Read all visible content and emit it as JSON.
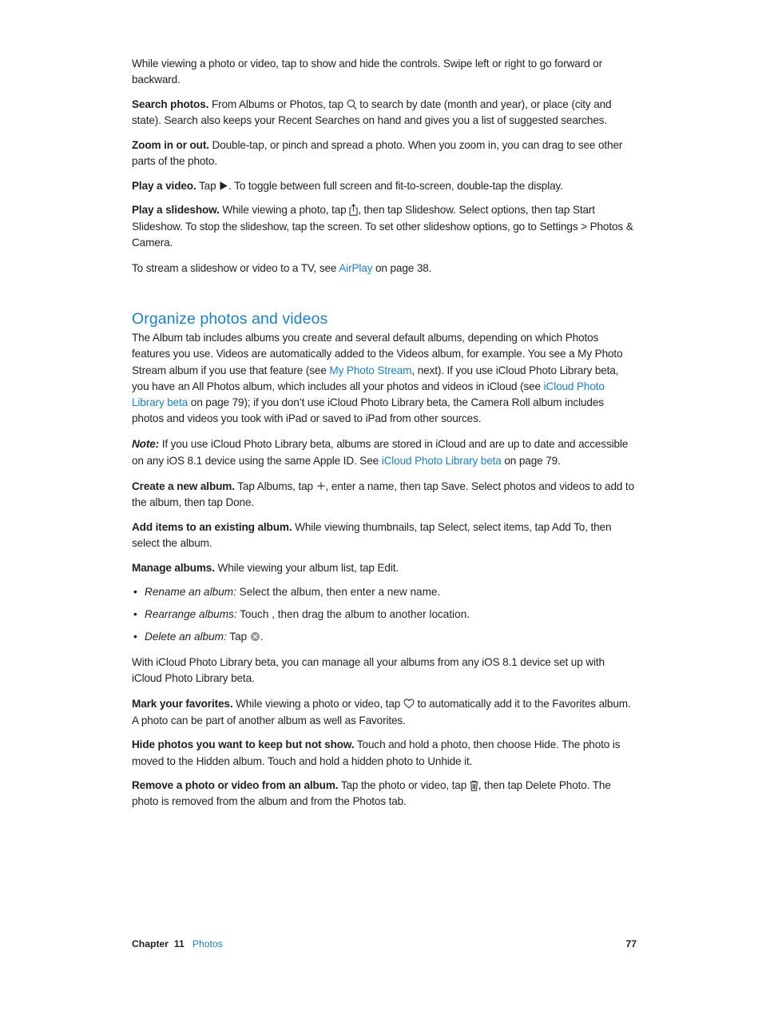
{
  "document": {
    "page_number": "77",
    "footer": {
      "chapter_word": "Chapter",
      "chapter_number": "11",
      "chapter_link": "Photos"
    }
  },
  "body": {
    "intro_paragraph": "While viewing a photo or video, tap to show and hide the controls. Swipe left or right to go forward or backward.",
    "search_photos": {
      "lead": "Search photos.",
      "text_before_icon": " From Albums or Photos, tap ",
      "icon": "search-icon",
      "text_after_icon": " to search by date (month and year), or place (city and state). Search also keeps your Recent Searches on hand and gives you a list of suggested searches."
    },
    "zoom_in_or_out": {
      "lead": "Zoom in or out.",
      "text": " Double-tap, or pinch and spread a photo. When you zoom in, you can drag to see other parts of the photo."
    },
    "play_a_video": {
      "lead": "Play a video.",
      "text_before_icon": " Tap ",
      "icon": "play-icon",
      "text_after_icon": ". To toggle between full screen and fit-to-screen, double-tap the display."
    },
    "play_a_slideshow": {
      "lead": "Play a slideshow.",
      "text_before_icon": " While viewing a photo, tap ",
      "icon": "share-icon",
      "text_after_icon": ", then tap Slideshow. Select options, then tap Start Slideshow. To stop the slideshow, tap the screen. To set other slideshow options, go to Settings > Photos & Camera."
    },
    "airplay_note": {
      "text_before_link": "To stream a slideshow or video to a TV, see ",
      "link": "AirPlay",
      "text_after_link": " on page 38."
    },
    "section_heading": "Organize photos and videos",
    "album_tab_paragraph": {
      "part1": "The Album tab includes albums you create and several default albums, depending on which Photos features you use. Videos are automatically added to the Videos album, for example. You see a My Photo Stream album if you use that feature (see ",
      "link1": "My Photo Stream",
      "part2": ", next). If you use iCloud Photo Library beta, you have an All Photos album, which includes all your photos and videos in iCloud (see ",
      "link2": "iCloud Photo Library beta",
      "part3": " on page 79); if you don’t use iCloud Photo Library beta, the Camera Roll album includes photos and videos you took with iPad or saved to iPad from other sources."
    },
    "note_paragraph": {
      "lead": "Note:",
      "part1": "  If you use iCloud Photo Library beta, albums are stored in iCloud and are up to date and accessible on any iOS 8.1 device using the same Apple ID. See ",
      "link": "iCloud Photo Library beta",
      "part2": " on page 79."
    },
    "create_new_album": {
      "lead": "Create a new album.",
      "text_before_icon": " Tap Albums, tap ",
      "icon": "plus-icon",
      "text_after_icon": ", enter a name, then tap Save. Select photos and videos to add to the album, then tap Done."
    },
    "add_items": {
      "lead": "Add items to an existing album.",
      "text": " While viewing thumbnails, tap Select, select items, tap Add To, then select the album."
    },
    "manage_albums": {
      "lead": "Manage albums.",
      "text": " While viewing your album list, tap Edit.",
      "bullets": [
        {
          "term": "Rename an album:",
          "text_before_icon": "  Select the album, then enter a new name.",
          "icon": null,
          "text_after_icon": ""
        },
        {
          "term": "Rearrange albums:",
          "text_before_icon": "  Touch , then drag the album to another location.",
          "icon": null,
          "text_after_icon": ""
        },
        {
          "term": "Delete an album:",
          "text_before_icon": "  Tap ",
          "icon": "delete-circle-icon",
          "text_after_icon": "."
        }
      ]
    },
    "icloud_manage_paragraph": "With iCloud Photo Library beta, you can manage all your albums from any iOS 8.1 device set up with iCloud Photo Library beta.",
    "mark_favorites": {
      "lead": "Mark your favorites.",
      "text_before_icon": " While viewing a photo or video, tap ",
      "icon": "heart-icon",
      "text_after_icon": " to automatically add it to the Favorites album. A photo can be part of another album as well as Favorites."
    },
    "hide_photos": {
      "lead": "Hide photos you want to keep but not show.",
      "text": " Touch and hold a photo, then choose Hide. The photo is moved to the Hidden album. Touch and hold a hidden photo to Unhide it."
    },
    "remove_photo": {
      "lead": "Remove a photo or video from an album.",
      "text_before_icon": " Tap the photo or video, tap ",
      "icon": "trash-icon",
      "text_after_icon": ", then tap Delete Photo. The photo is removed from the album and from the Photos tab."
    }
  },
  "colors": {
    "link": "#1b7fd0",
    "heading": "#1b7fd0",
    "body_text": "#231f20",
    "delete_icon_fill": "#9a9a9a",
    "page_background": "#ffffff"
  }
}
